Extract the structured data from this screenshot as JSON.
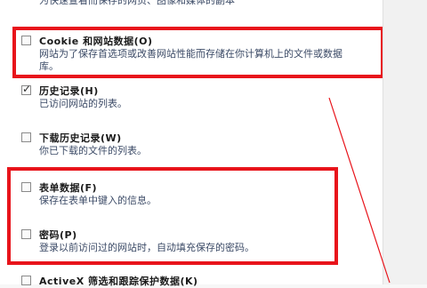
{
  "top_fragment": "为快速查看而保存的网页、图像和媒体的副本",
  "items": [
    {
      "title": "Cookie 和网站数据(O)",
      "desc": "网站为了保存首选项或改善网站性能而存储在你计算机上的文件或数据库。",
      "checked": false
    },
    {
      "title": "历史记录(H)",
      "desc": "已访问网站的列表。",
      "checked": true
    },
    {
      "title": "下载历史记录(W)",
      "desc": "你已下载的文件的列表。",
      "checked": false
    },
    {
      "title": "表单数据(F)",
      "desc": "保存在表单中键入的信息。",
      "checked": false
    },
    {
      "title": "密码(P)",
      "desc": "登录以前访问过的网站时，自动填充保存的密码。",
      "checked": false
    },
    {
      "title": "ActiveX 筛选和跟踪保护数据(K)",
      "desc": "",
      "checked": false
    }
  ],
  "colors": {
    "highlight": "#e8141b",
    "description": "#3b4a66"
  }
}
